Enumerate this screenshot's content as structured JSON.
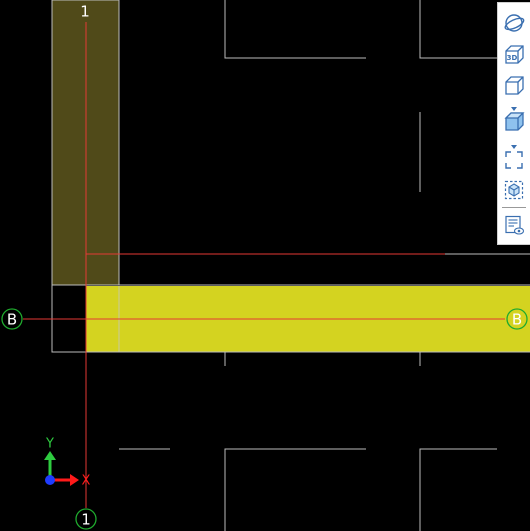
{
  "grid": {
    "vertical_label": "1",
    "horizontal_label": "B"
  },
  "axis_indicator": {
    "y_label": "Y",
    "x_label": "X"
  },
  "colors": {
    "background": "#000000",
    "grid_line": "#e53935",
    "wall_outline": "#bdbdbd",
    "column_fill": "#504a19",
    "beam_selected_fill": "#d4d320",
    "bubble_outline": "#1faa2e",
    "axis_y": "#2ecc40",
    "axis_x": "#ff1a1a",
    "axis_origin": "#1f3cff",
    "toolbar_icon": "#3a6fb0"
  },
  "toolbar": {
    "items": [
      {
        "name": "orbit-icon"
      },
      {
        "name": "3d-view-icon",
        "text": "3D"
      },
      {
        "name": "view-cube-icon"
      },
      {
        "name": "shaded-cube-icon"
      },
      {
        "name": "zoom-extents-icon"
      },
      {
        "name": "zoom-selection-icon"
      },
      {
        "name": "view-properties-icon"
      }
    ]
  }
}
